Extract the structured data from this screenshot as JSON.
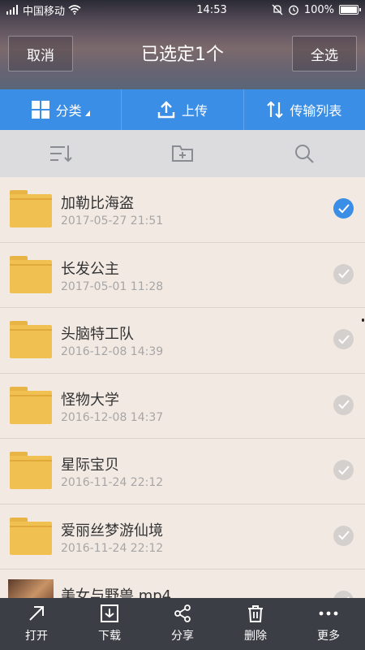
{
  "status": {
    "carrier": "中国移动",
    "time": "14:53",
    "battery": "100%",
    "battery_level": 1.0
  },
  "header": {
    "cancel_label": "取消",
    "title": "已选定1个",
    "select_all_label": "全选"
  },
  "toolbar": {
    "category_label": "分类",
    "upload_label": "上传",
    "transfer_label": "传输列表"
  },
  "actions": {
    "sort_icon": "sort-icon",
    "new_folder_icon": "new-folder-icon",
    "search_icon": "search-icon"
  },
  "files": [
    {
      "name": "加勒比海盗",
      "date": "2017-05-27  21:51",
      "type": "folder",
      "selected": true
    },
    {
      "name": "长发公主",
      "date": "2017-05-01  11:28",
      "type": "folder",
      "selected": false
    },
    {
      "name": "头脑特工队",
      "date": "2016-12-08  14:39",
      "type": "folder",
      "selected": false
    },
    {
      "name": "怪物大学",
      "date": "2016-12-08  14:37",
      "type": "folder",
      "selected": false
    },
    {
      "name": "星际宝贝",
      "date": "2016-11-24  22:12",
      "type": "folder",
      "selected": false
    },
    {
      "name": "爱丽丝梦游仙境",
      "date": "2016-11-24  22:12",
      "type": "folder",
      "selected": false
    },
    {
      "name": "美女与野兽.mp4",
      "date": "",
      "type": "video",
      "selected": false
    }
  ],
  "bottom": {
    "open_label": "打开",
    "download_label": "下载",
    "share_label": "分享",
    "delete_label": "删除",
    "more_label": "更多"
  },
  "colors": {
    "accent": "#3a8ee6",
    "folder": "#f0c050",
    "bottom_bar": "#3c3e45"
  }
}
